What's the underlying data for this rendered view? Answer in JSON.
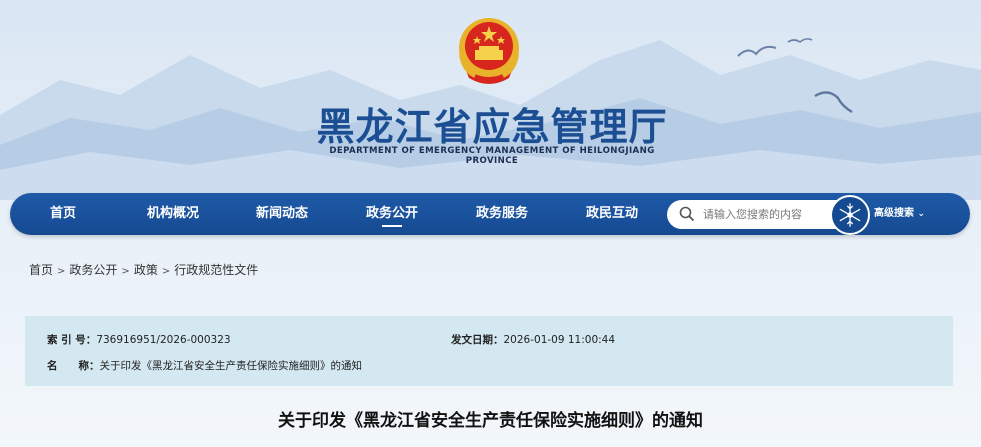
{
  "header": {
    "title": "黑龙江省应急管理厅",
    "subtitle": "DEPARTMENT OF EMERGENCY MANAGEMENT OF HEILONGJIANG PROVINCE",
    "emblem_icon": "national-emblem-icon"
  },
  "nav": {
    "items": [
      {
        "label": "首页"
      },
      {
        "label": "机构概况"
      },
      {
        "label": "新闻动态"
      },
      {
        "label": "政务公开",
        "active": true
      },
      {
        "label": "政务服务"
      },
      {
        "label": "政民互动"
      }
    ],
    "search_placeholder": "请输入您搜索的内容",
    "advanced_label": "高级搜索",
    "accent_color": "#154a91"
  },
  "breadcrumb": [
    "首页",
    "政务公开",
    "政策",
    "行政规范性文件"
  ],
  "meta": {
    "index_label": "索 引 号：",
    "index_value": "736916951/2026-000323",
    "date_label": "发文日期：",
    "date_value": "2026-01-09 11:00:44",
    "name_label": "名　　称：",
    "name_value": "关于印发《黑龙江省安全生产责任保险实施细则》的通知"
  },
  "article": {
    "title": "关于印发《黑龙江省安全生产责任保险实施细则》的通知"
  }
}
